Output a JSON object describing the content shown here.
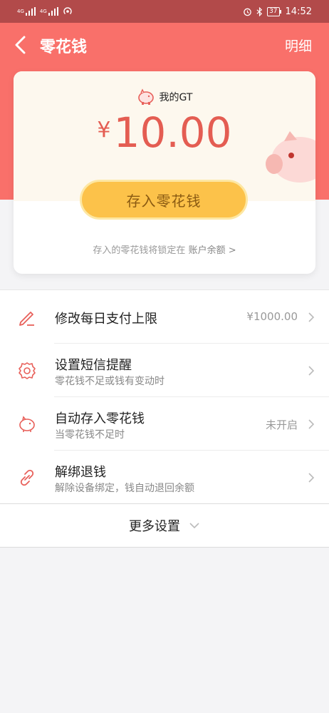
{
  "status_bar": {
    "network_1": "4G",
    "network_2": "4G",
    "battery": "37",
    "time": "14:52"
  },
  "header": {
    "title": "零花钱",
    "detail_label": "明细"
  },
  "card": {
    "account_name": "我的GT",
    "currency_symbol": "¥",
    "balance": "10.00",
    "deposit_button": "存入零花钱",
    "lock_note": "存入的零花钱将锁定在",
    "lock_link": "账户余额 >"
  },
  "menu": {
    "items": [
      {
        "title": "修改每日支付上限",
        "value": "¥1000.00",
        "icon": "edit-icon"
      },
      {
        "title": "设置短信提醒",
        "subtitle": "零花钱不足或钱有变动时",
        "icon": "gear-icon"
      },
      {
        "title": "自动存入零花钱",
        "subtitle": "当零花钱不足时",
        "value": "未开启",
        "icon": "piggy-bank-icon"
      },
      {
        "title": "解绑退钱",
        "subtitle": "解除设备绑定，钱自动退回余额",
        "icon": "unlink-icon"
      }
    ]
  },
  "more_settings": {
    "label": "更多设置"
  },
  "colors": {
    "accent": "#f9706a",
    "status_bar": "#b24a4a",
    "button": "#fcc24a",
    "amount": "#e45d52",
    "icon": "#e8605a"
  }
}
